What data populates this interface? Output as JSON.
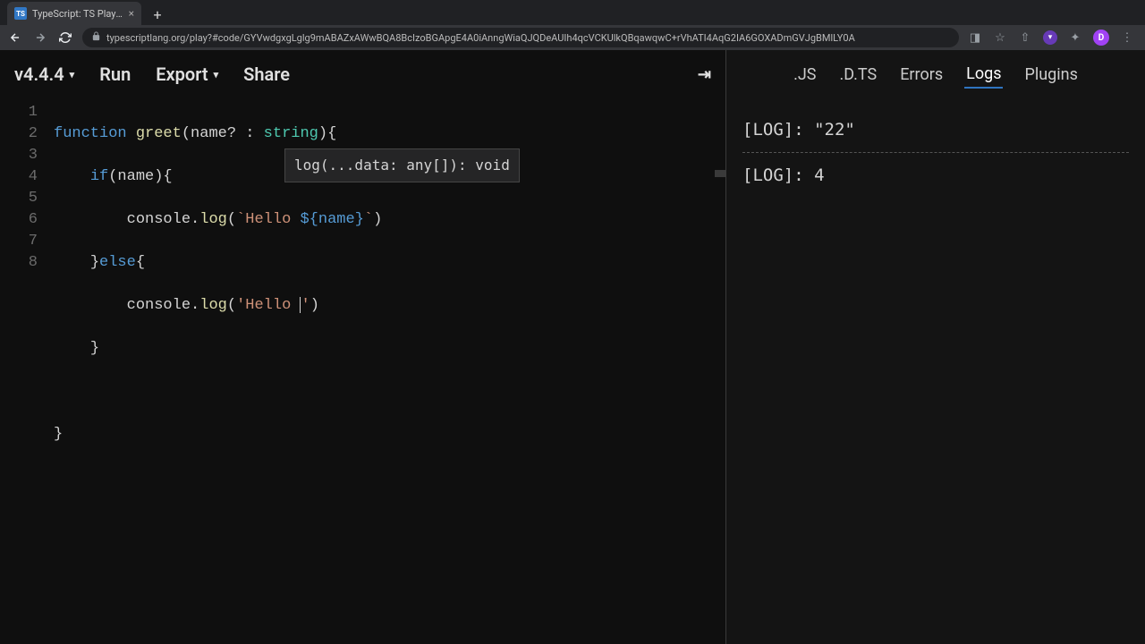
{
  "browser": {
    "tab": {
      "favicon": "TS",
      "title": "TypeScript: TS Playground - A"
    },
    "url": "typescriptlang.org/play?#code/GYVwdgxgLglg9mABAZxAWwBQA8BcIzoBGApgE4A0iAnngWiaQJQDeAUIh4qcVCKUlkQBqawqwC+rVhATI4AqG2IA6GOXADmGVJgBMlLY0A"
  },
  "toolbar": {
    "version": "v4.4.4",
    "run": "Run",
    "export": "Export",
    "share": "Share"
  },
  "outputTabs": {
    "js": ".JS",
    "dts": ".D.TS",
    "errors": "Errors",
    "logs": "Logs",
    "plugins": "Plugins",
    "active": "logs"
  },
  "code": {
    "lineNumbers": [
      "1",
      "2",
      "3",
      "4",
      "5",
      "6",
      "7",
      "8"
    ],
    "l1": {
      "kw": "function",
      "fn": "greet",
      "p1": "(name? : ",
      "type": "string",
      "p2": "){"
    },
    "l2": {
      "kw": "if",
      "rest": "(name){"
    },
    "l3": {
      "obj": "console",
      "dot": ".",
      "fn": "log",
      "paren": "(",
      "tick": "`",
      "str": "Hello ",
      "interp": "${name}",
      "tick2": "`",
      "close": ")"
    },
    "l4": {
      "brace": "}",
      "kw": "else",
      "open": "{"
    },
    "l5": {
      "obj": "console",
      "dot": ".",
      "fn": "log",
      "open": "(",
      "q": "'",
      "str": "Hello ",
      "q2": "'",
      "close": ")"
    },
    "l6": {
      "brace": "}"
    },
    "l8": {
      "brace": "}"
    }
  },
  "hint": "log(...data: any[]): void",
  "logs": {
    "line1": "[LOG]: \"22\"",
    "line2": "[LOG]: 4"
  }
}
